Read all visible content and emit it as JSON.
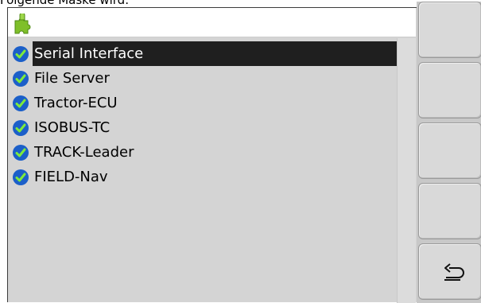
{
  "caption": "Folgende Maske wird:",
  "list": {
    "items": [
      {
        "label": "Serial Interface",
        "selected": true
      },
      {
        "label": "File Server",
        "selected": false
      },
      {
        "label": "Tractor-ECU",
        "selected": false
      },
      {
        "label": "ISOBUS-TC",
        "selected": false
      },
      {
        "label": "TRACK-Leader",
        "selected": false
      },
      {
        "label": "FIELD-Nav",
        "selected": false
      }
    ]
  },
  "icons": {
    "header": "puzzle-piece-icon",
    "item_status": "check-circle-icon",
    "back": "return-arrow-icon"
  },
  "softkeys": [
    {
      "name": "softkey-1",
      "icon": ""
    },
    {
      "name": "softkey-2",
      "icon": ""
    },
    {
      "name": "softkey-3",
      "icon": ""
    },
    {
      "name": "softkey-4",
      "icon": ""
    },
    {
      "name": "softkey-back",
      "icon": "return-arrow-icon"
    }
  ],
  "colors": {
    "selection": "#1f1f1f",
    "check_blue": "#1b5fc9",
    "puzzle_green": "#7fbf2a"
  }
}
